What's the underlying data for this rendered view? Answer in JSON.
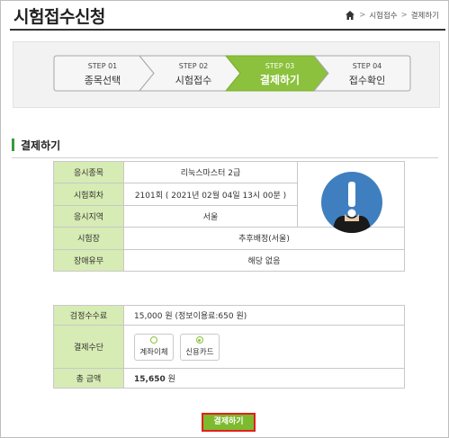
{
  "header": {
    "title": "시험접수신청",
    "breadcrumb": [
      "시험접수",
      "결제하기"
    ],
    "breadcrumb_sep": ">"
  },
  "steps": [
    {
      "label": "STEP 01",
      "name": "종목선택",
      "active": false
    },
    {
      "label": "STEP 02",
      "name": "시험접수",
      "active": false
    },
    {
      "label": "STEP 03",
      "name": "결제하기",
      "active": true
    },
    {
      "label": "STEP 04",
      "name": "접수확인",
      "active": false
    }
  ],
  "section": {
    "title": "결제하기"
  },
  "exam_info": {
    "rows": [
      {
        "label": "응시종목",
        "value": "리눅스마스터 2급"
      },
      {
        "label": "시험회차",
        "value": "2101회 ( 2021년 02월 04일 13시 00분 )"
      },
      {
        "label": "응시지역",
        "value": "서울"
      },
      {
        "label": "시험장",
        "value": "추후배정(서울)"
      },
      {
        "label": "장애유무",
        "value": "해당 없음"
      }
    ]
  },
  "payment": {
    "fee_label": "검정수수료",
    "fee_value": "15,000  원 (정보이용료:650 원)",
    "method_label": "결제수단",
    "methods": [
      {
        "name": "계좌이체",
        "selected": false
      },
      {
        "name": "신용카드",
        "selected": true
      }
    ],
    "total_label": "총 금액",
    "total_amount": "15,650",
    "total_unit": "원"
  },
  "submit": {
    "label": "결제하기"
  },
  "colors": {
    "accent": "#8bc13c",
    "header_cell": "#d7ebb4",
    "button_outline": "#e41f1f",
    "avatar_blue": "#3f7fbf"
  }
}
